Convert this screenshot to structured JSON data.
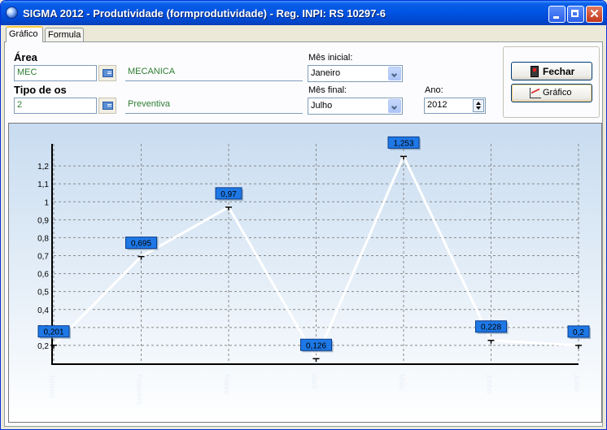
{
  "window": {
    "title": "SIGMA 2012 - Produtividade  (formprodutividade)  - Reg. INPI: RS 10297-6"
  },
  "tabs": [
    {
      "label": "Gráfico"
    },
    {
      "label": "Formula"
    }
  ],
  "form": {
    "area_label": "Área",
    "area_code": "MEC",
    "area_desc": "MECANICA",
    "tipo_label": "Tipo de os",
    "tipo_code": "2",
    "tipo_desc": "Preventiva",
    "mes_inicial_label": "Mês inicial:",
    "mes_inicial_value": "Janeiro",
    "mes_final_label": "Mês final:",
    "mes_final_value": "Julho",
    "ano_label": "Ano:",
    "ano_value": "2012"
  },
  "buttons": {
    "fechar": "Fechar",
    "grafico": "Gráfico"
  },
  "colors": {
    "line": "#ffffff",
    "label_bg": "#1e78e6",
    "bg_top": "#c8dcf0",
    "bg_bottom": "#ffffff"
  },
  "chart_data": {
    "type": "line",
    "categories": [
      "Janeiro",
      "Fevereiro",
      "Março",
      "Abril",
      "Maio",
      "Junho",
      "Julho"
    ],
    "values": [
      0.201,
      0.695,
      0.97,
      0.126,
      1.253,
      0.228,
      0.2
    ],
    "value_labels": [
      "0,201",
      "0,695",
      "0,97",
      "0,126",
      "1,253",
      "0,228",
      "0,2"
    ],
    "y_ticks": [
      "0,2",
      "0,3",
      "0,4",
      "0,5",
      "0,6",
      "0,7",
      "0,8",
      "0,9",
      "1",
      "1,1",
      "1,2"
    ],
    "ylim": [
      0.1,
      1.3
    ],
    "grid": true,
    "title": "",
    "xlabel": "",
    "ylabel": ""
  }
}
